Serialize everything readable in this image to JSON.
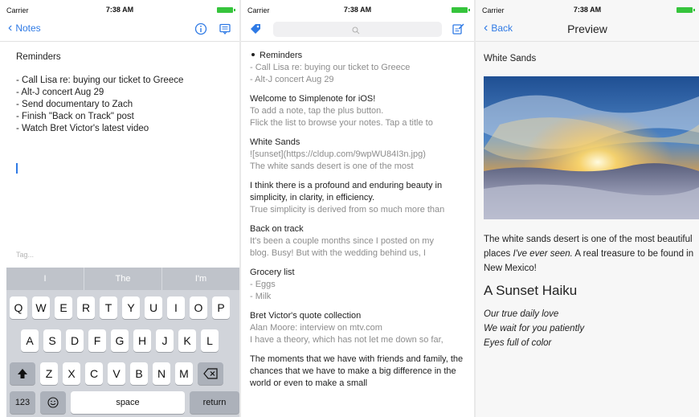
{
  "status": {
    "carrier": "Carrier",
    "time": "7:38 AM"
  },
  "screen1": {
    "back_label": "Notes",
    "note": {
      "title": "Reminders",
      "lines": [
        "- Call Lisa re: buying our ticket to Greece",
        "- Alt-J concert Aug 29",
        "- Send documentary to Zach",
        "- Finish \"Back on Track\" post",
        "- Watch Bret Victor's latest video"
      ]
    },
    "tag_placeholder": "Tag...",
    "keyboard": {
      "suggestions": [
        "I",
        "The",
        "I'm"
      ],
      "row1": [
        "Q",
        "W",
        "E",
        "R",
        "T",
        "Y",
        "U",
        "I",
        "O",
        "P"
      ],
      "row2": [
        "A",
        "S",
        "D",
        "F",
        "G",
        "H",
        "J",
        "K",
        "L"
      ],
      "row3": [
        "Z",
        "X",
        "C",
        "V",
        "B",
        "N",
        "M"
      ],
      "numbers_label": "123",
      "space_label": "space",
      "return_label": "return"
    }
  },
  "screen2": {
    "notes": [
      {
        "title": "Reminders",
        "preview": [
          "- Call Lisa re: buying our ticket to Greece",
          "- Alt-J concert Aug 29"
        ],
        "pinned": true
      },
      {
        "title": "Welcome to Simplenote for iOS!",
        "preview": [
          "To add a note, tap the plus button.",
          "Flick the list to browse your notes. Tap a title to"
        ]
      },
      {
        "title": "White Sands",
        "preview": [
          "![sunset](https://cldup.com/9wpWU84I3n.jpg)",
          "The white sands desert is one of the most"
        ]
      },
      {
        "title": "I think there is a profound and enduring beauty in simplicity, in clarity, in efficiency.",
        "preview": [
          "True simplicity is derived from so much more than"
        ]
      },
      {
        "title": "Back on track",
        "preview": [
          "It's been a couple months since I posted on my",
          "blog. Busy! But with the wedding behind us, I"
        ]
      },
      {
        "title": "Grocery list",
        "preview": [
          "- Eggs",
          "- Milk"
        ]
      },
      {
        "title": "Bret Victor's quote collection",
        "preview": [
          "Alan Moore: interview on mtv.com",
          "I have a theory, which has not let me down so far,"
        ]
      },
      {
        "title": "The moments that we have with friends and family, the chances that we have to make a big difference in the world or even to make a small",
        "preview": []
      }
    ]
  },
  "screen3": {
    "back_label": "Back",
    "title": "Preview",
    "heading": "White Sands",
    "para_1": "The white sands desert is one of the most beautiful places ",
    "para_em": "I've ever seen.",
    "para_2": " A real treasure to be found in New Mexico!",
    "subheading": "A Sunset Haiku",
    "haiku": [
      "Our true daily love",
      "We wait for you patiently",
      "Eyes full of color"
    ]
  },
  "colors": {
    "accent": "#2f7ae5",
    "battery": "#36c43c"
  }
}
